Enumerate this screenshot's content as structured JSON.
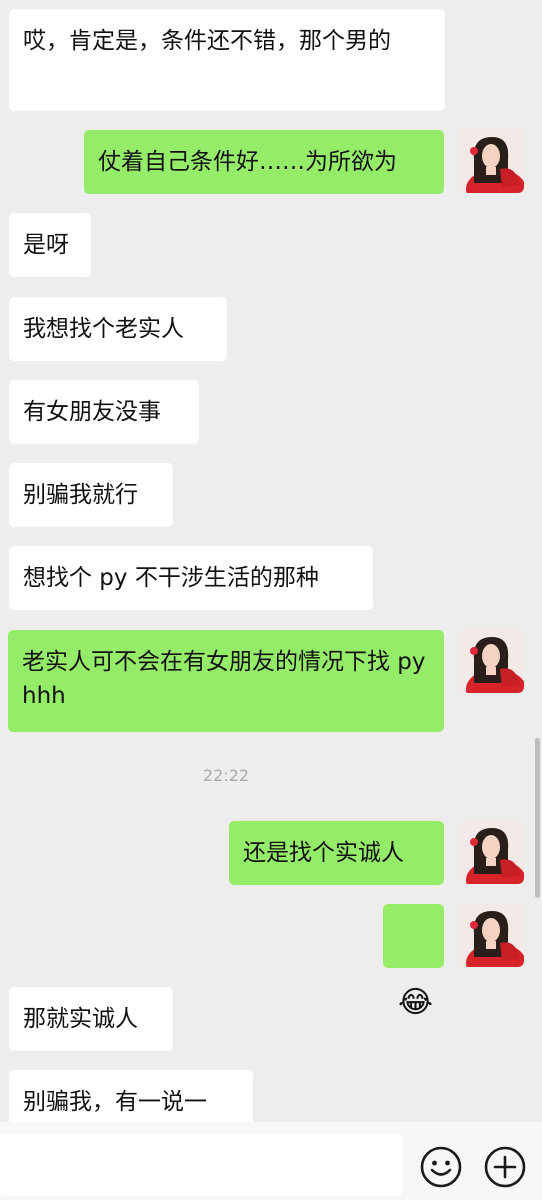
{
  "messages": [
    {
      "side": "in",
      "text": "哎，肯定是，条件还不错，那个男的"
    },
    {
      "side": "out",
      "text": "仗着自己条件好……为所欲为"
    },
    {
      "side": "in",
      "text": "是呀"
    },
    {
      "side": "in",
      "text": "我想找个老实人"
    },
    {
      "side": "in",
      "text": "有女朋友没事"
    },
    {
      "side": "in",
      "text": "别骗我就行"
    },
    {
      "side": "in",
      "text": "想找个 py 不干涉生活的那种"
    },
    {
      "side": "out",
      "text": "老实人可不会在有女朋友的情况下找 pyhhh"
    },
    {
      "side": "out",
      "text": "还是找个实诚人"
    },
    {
      "side": "out",
      "emoji": "😂"
    },
    {
      "side": "in",
      "text": "那就实诚人"
    },
    {
      "side": "in",
      "text": "别骗我，有一说一"
    }
  ],
  "timestamp": "22:22",
  "input": {
    "value": "",
    "placeholder": ""
  },
  "icons": {
    "emoji_button": "smiley-icon",
    "more_button": "plus-circle-icon"
  },
  "colors": {
    "background": "#ededed",
    "incoming_bubble": "#ffffff",
    "outgoing_bubble": "#95ec69"
  }
}
